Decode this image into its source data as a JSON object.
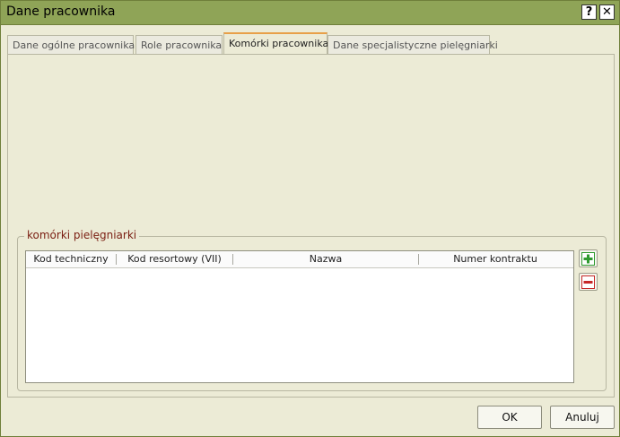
{
  "window": {
    "title": "Dane pracownika",
    "help_label": "?",
    "close_label": "✕"
  },
  "tabs": [
    {
      "label": "Dane ogólne pracownika",
      "active": false
    },
    {
      "label": "Role pracownika",
      "active": false
    },
    {
      "label": "Komórki pracownika",
      "active": true
    },
    {
      "label": "Dane specjalistyczne pielęgniarki",
      "active": false
    }
  ],
  "group": {
    "title": "komórki pielęgniarki",
    "columns": [
      "Kod techniczny",
      "Kod resortowy (VII)",
      "Nazwa",
      "Numer kontraktu"
    ],
    "rows": []
  },
  "actions": {
    "add_icon": "plus-icon",
    "remove_icon": "minus-icon"
  },
  "footer": {
    "ok_label": "OK",
    "cancel_label": "Anuluj"
  },
  "colors": {
    "titlebar": "#8fa457",
    "background": "#ecebd6",
    "active_tab_accent": "#e8a048",
    "group_title": "#7a1e12",
    "add_icon_color": "#2f9a2f",
    "remove_icon_color": "#c62828"
  }
}
